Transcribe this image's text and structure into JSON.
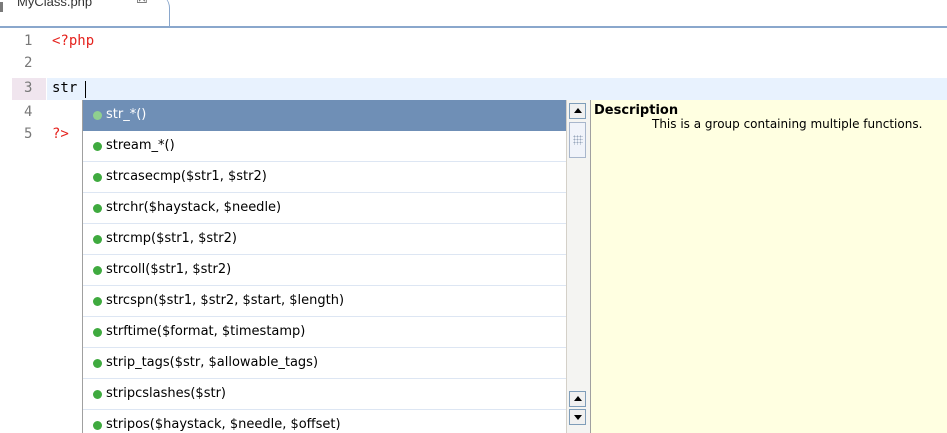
{
  "tab": {
    "title": "MyClass.php",
    "close_glyph": "☒"
  },
  "editor": {
    "lines": [
      {
        "number": "1",
        "code": "<?php",
        "kind": "php-tag"
      },
      {
        "number": "2",
        "code": "",
        "kind": "plain"
      },
      {
        "number": "3",
        "code": "str",
        "kind": "plain"
      },
      {
        "number": "4",
        "code": "",
        "kind": "plain"
      },
      {
        "number": "5",
        "code": "?>",
        "kind": "php-tag"
      }
    ],
    "current_line": "3"
  },
  "completion": {
    "items": [
      {
        "label": "str_*()",
        "selected": true
      },
      {
        "label": "stream_*()"
      },
      {
        "label": "strcasecmp($str1, $str2)"
      },
      {
        "label": "strchr($haystack, $needle)"
      },
      {
        "label": "strcmp($str1, $str2)"
      },
      {
        "label": "strcoll($str1, $str2)"
      },
      {
        "label": "strcspn($str1, $str2, $start, $length)"
      },
      {
        "label": "strftime($format, $timestamp)"
      },
      {
        "label": "strip_tags($str, $allowable_tags)"
      },
      {
        "label": "stripcslashes($str)"
      },
      {
        "label": "stripos($haystack, $needle, $offset)"
      }
    ],
    "icon": "function-dot-icon"
  },
  "description": {
    "title": "Description",
    "body": "This is a group containing multiple functions."
  },
  "colors": {
    "php_tag": "#e5231e",
    "selection": "#6f8fb6",
    "description_bg": "#ffffe1",
    "current_line": "#e8f2fe"
  }
}
